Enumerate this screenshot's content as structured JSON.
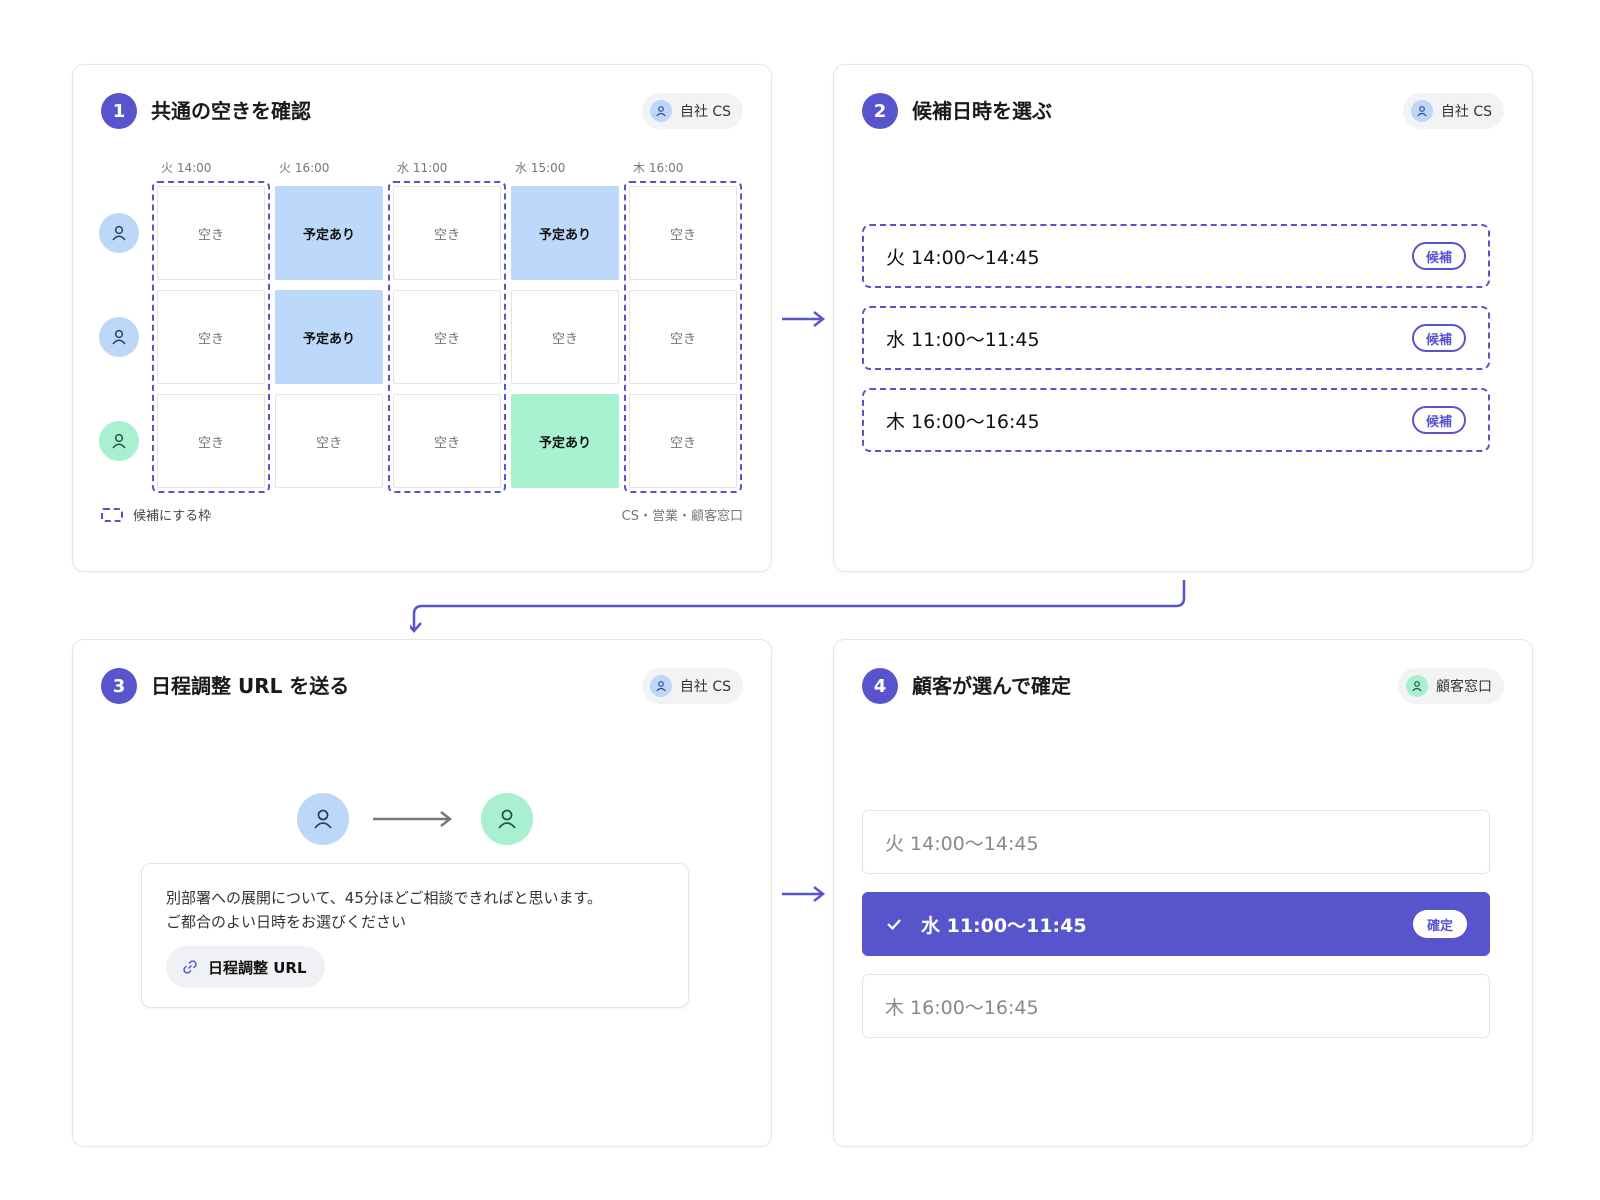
{
  "colors": {
    "accent": "#5855cc",
    "busy_blue": "#bcd9fc",
    "busy_green": "#a8f2d2",
    "avatar_blue": "#bcd7f8",
    "avatar_green": "#a8f0d0"
  },
  "steps": [
    {
      "number": "1",
      "title": "共通の空きを確認",
      "role": "自社 CS"
    },
    {
      "number": "2",
      "title": "候補日時を選ぶ",
      "role": "自社 CS"
    },
    {
      "number": "3",
      "title": "日程調整 URL を送る",
      "role": "自社 CS"
    },
    {
      "number": "4",
      "title": "顧客が選んで確定",
      "role": "顧客窓口"
    }
  ],
  "availability": {
    "slots": [
      "火 14:00",
      "火 16:00",
      "水 11:00",
      "水 15:00",
      "木 16:00"
    ],
    "rows": [
      {
        "avatar": "person-icon-blue",
        "cells": [
          "空き",
          "予定あり",
          "空き",
          "予定あり",
          "空き"
        ]
      },
      {
        "avatar": "person-icon-blue",
        "cells": [
          "空き",
          "予定あり",
          "空き",
          "空き",
          "空き"
        ]
      },
      {
        "avatar": "person-icon-green",
        "cells": [
          "空き",
          "空き",
          "空き",
          "予定あり",
          "空き"
        ]
      }
    ],
    "legend": "候補にする枠",
    "members": "CS・営業・顧客窓口"
  },
  "candidates": [
    {
      "time": "火 14:00〜14:45",
      "tag": "候補"
    },
    {
      "time": "水 11:00〜11:45",
      "tag": "候補"
    },
    {
      "time": "木 16:00〜16:45",
      "tag": "候補"
    }
  ],
  "message": {
    "text": "別部署への展開について、45分ほどご相談できればと思います。\nご都合のよい日時をお選びください",
    "link_label": "日程調整 URL"
  },
  "customer_choice": {
    "options": [
      "火 14:00〜14:45",
      "水 11:00〜11:45",
      "木 16:00〜16:45"
    ],
    "selected": "水 11:00〜11:45",
    "confirm_label": "確定"
  }
}
